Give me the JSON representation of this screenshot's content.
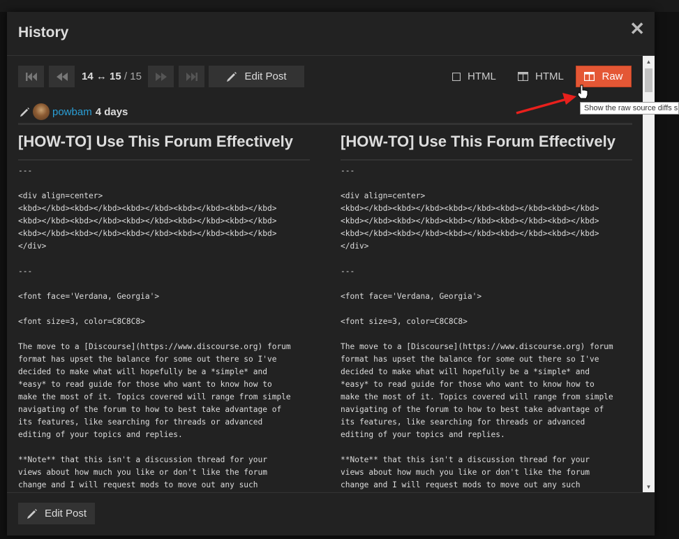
{
  "modal": {
    "title": "History",
    "close_glyph": "✕"
  },
  "revisions": {
    "from": "14",
    "arrow": "↔",
    "to": "15",
    "separator": "/",
    "total": "15"
  },
  "toolbar": {
    "edit_post_label": "Edit Post",
    "mode_inline_label": "HTML",
    "mode_side_by_side_label": "HTML",
    "mode_raw_label": "Raw",
    "raw_tooltip": "Show the raw source diffs side-by-side",
    "raw_color": "#e45735"
  },
  "byline": {
    "username": "powbam",
    "age": "4 days",
    "username_color": "#2a9fd6"
  },
  "diff": {
    "left_title": "[HOW-TO] Use This Forum Effectively",
    "right_title": "[HOW-TO] Use This Forum Effectively",
    "left_body": "---\n\n<div align=center>\n<kbd></kbd><kbd></kbd><kbd></kbd><kbd></kbd><kbd></kbd>\n<kbd></kbd><kbd></kbd><kbd></kbd><kbd></kbd><kbd></kbd>\n<kbd></kbd><kbd></kbd><kbd></kbd><kbd></kbd><kbd></kbd>\n</div>\n\n---\n\n<font face='Verdana, Georgia'>\n\n<font size=3, color=C8C8C8>\n\nThe move to a [Discourse](https://www.discourse.org) forum\nformat has upset the balance for some out there so I've\ndecided to make what will hopefully be a *simple* and\n*easy* to read guide for those who want to know how to\nmake the most of it. Topics covered will range from simple\nnavigating of the forum to how to best take advantage of\nits features, like searching for threads or advanced\nediting of your topics and replies.\n\n**Note** that this isn't a discussion thread for your\nviews about how much you like or don't like the forum\nchange and I will request mods to move out any such",
    "right_body": "---\n\n<div align=center>\n<kbd></kbd><kbd></kbd><kbd></kbd><kbd></kbd><kbd></kbd>\n<kbd></kbd><kbd></kbd><kbd></kbd><kbd></kbd><kbd></kbd>\n<kbd></kbd><kbd></kbd><kbd></kbd><kbd></kbd><kbd></kbd>\n</div>\n\n---\n\n<font face='Verdana, Georgia'>\n\n<font size=3, color=C8C8C8>\n\nThe move to a [Discourse](https://www.discourse.org) forum\nformat has upset the balance for some out there so I've\ndecided to make what will hopefully be a *simple* and\n*easy* to read guide for those who want to know how to\nmake the most of it. Topics covered will range from simple\nnavigating of the forum to how to best take advantage of\nits features, like searching for threads or advanced\nediting of your topics and replies.\n\n**Note** that this isn't a discussion thread for your\nviews about how much you like or don't like the forum\nchange and I will request mods to move out any such"
  },
  "footer": {
    "edit_post_label": "Edit Post"
  },
  "annotation": {
    "arrow_color": "#e8201c"
  }
}
